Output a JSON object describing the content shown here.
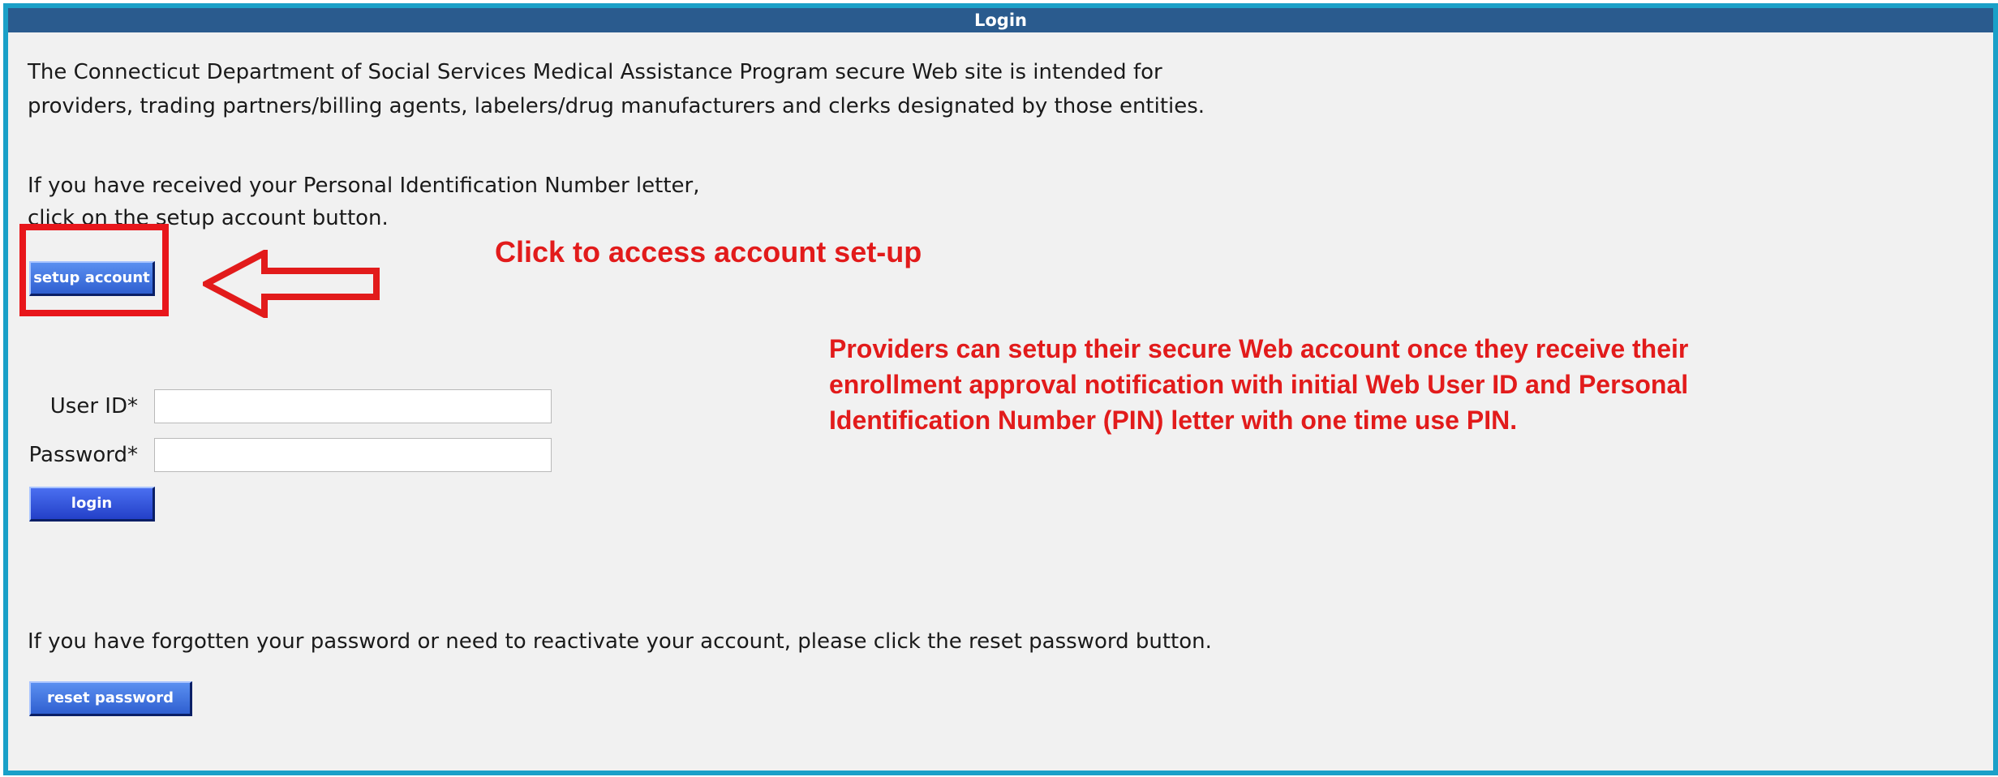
{
  "title": "Login",
  "intro": {
    "line1": "The Connecticut Department of Social Services Medical Assistance Program secure Web site is intended for",
    "line2": "providers, trading partners/billing agents, labelers/drug manufacturers and clerks designated by those entities."
  },
  "pin_text": {
    "line1": "If you have received your Personal Identification Number letter,",
    "line2": "click on the setup account button."
  },
  "buttons": {
    "setup_account": "setup account",
    "login": "login",
    "reset_password": "reset password"
  },
  "form": {
    "user_id_label": "User ID*",
    "password_label": "Password*",
    "user_id_value": "",
    "password_value": ""
  },
  "forgot_text": "If you have forgotten your password or need to reactivate your account, please click the reset password button.",
  "annotations": {
    "arrow_label": "Click to access account set-up",
    "note_line1": "Providers can setup their secure Web account once they receive their",
    "note_line2": "enrollment approval notification with initial Web User ID and Personal",
    "note_line3": "Identification Number (PIN) letter with one time use PIN.",
    "color": "#e21b1b"
  }
}
